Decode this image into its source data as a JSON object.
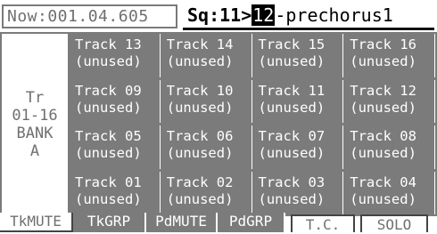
{
  "header": {
    "now_label": "Now:001.04.605",
    "seq_prefix": "Sq:11>",
    "seq_number": "12",
    "seq_name": "-prechorus1"
  },
  "bank": {
    "text": "Tr\n01-16\nBANK\nA"
  },
  "tracks": [
    {
      "name": "Track 13",
      "status": "(unused)"
    },
    {
      "name": "Track 14",
      "status": "(unused)"
    },
    {
      "name": "Track 15",
      "status": "(unused)"
    },
    {
      "name": "Track 16",
      "status": "(unused)"
    },
    {
      "name": "Track 09",
      "status": "(unused)"
    },
    {
      "name": "Track 10",
      "status": "(unused)"
    },
    {
      "name": "Track 11",
      "status": "(unused)"
    },
    {
      "name": "Track 12",
      "status": "(unused)"
    },
    {
      "name": "Track 05",
      "status": "(unused)"
    },
    {
      "name": "Track 06",
      "status": "(unused)"
    },
    {
      "name": "Track 07",
      "status": "(unused)"
    },
    {
      "name": "Track 08",
      "status": "(unused)"
    },
    {
      "name": "Track 01",
      "status": "(unused)"
    },
    {
      "name": "Track 02",
      "status": "(unused)"
    },
    {
      "name": "Track 03",
      "status": "(unused)"
    },
    {
      "name": "Track 04",
      "status": "(unused)"
    }
  ],
  "tabs": {
    "tkmute": "TkMUTE",
    "tkgrp": "TkGRP",
    "pdmute": "PdMUTE",
    "pdgrp": "PdGRP",
    "tc": "T.C.",
    "solo": "SOLO"
  },
  "colors": {
    "cell_bg": "#7b7b7b",
    "cell_text": "#ffffff",
    "header_text": "#6f6f6f"
  }
}
